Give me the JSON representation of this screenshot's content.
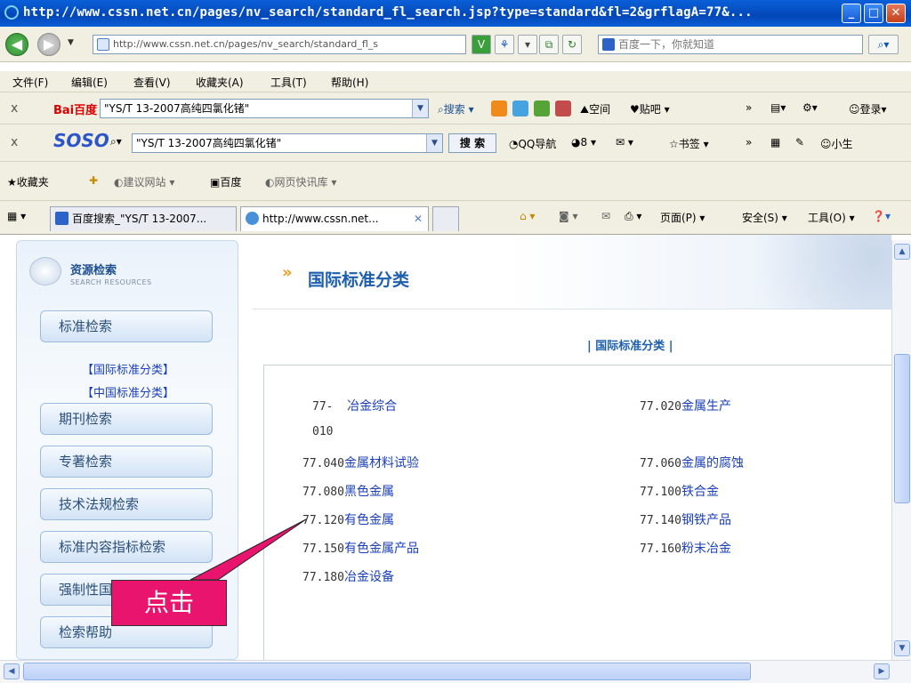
{
  "window": {
    "title": "http://www.cssn.net.cn/pages/nv_search/standard_fl_search.jsp?type=standard&fl=2&grflagA=77&..."
  },
  "address": {
    "url": "http://www.cssn.net.cn/pages/nv_search/standard_fl_s",
    "search_text": "百度一下，你就知道"
  },
  "menu": [
    "文件(F)",
    "编辑(E)",
    "查看(V)",
    "收藏夹(A)",
    "工具(T)",
    "帮助(H)"
  ],
  "baidu_toolbar": {
    "logo": "Bai百度",
    "query": "\"YS/T 13-2007高纯四氯化锗\"",
    "search": "搜索",
    "space": "空间",
    "tieba": "贴吧",
    "login": "登录"
  },
  "soso_toolbar": {
    "logo": "SOSO",
    "query": "\"YS/T 13-2007高纯四氯化锗\"",
    "search": "搜 索",
    "qqnav": "QQ导航",
    "count": "8",
    "bookmarks": "书签",
    "more": "»",
    "user": "小生"
  },
  "favorites_bar": {
    "favorites": "收藏夹",
    "suggested": "建议网站",
    "baidu": "百度",
    "webslice": "网页快讯库"
  },
  "tabs": [
    {
      "label": "百度搜索_\"YS/T 13-2007..."
    },
    {
      "label": "http://www.cssn.net..."
    }
  ],
  "ie_commands": {
    "page": "页面(P)",
    "safety": "安全(S)",
    "tools": "工具(O)"
  },
  "sidebar": {
    "title": "资源检索",
    "subtitle": "SEARCH RESOURCES",
    "items": [
      "标准检索",
      "期刊检索",
      "专著检索",
      "技术法规检索",
      "标准内容指标检索",
      "强制性国",
      "检索帮助"
    ],
    "sublinks": [
      "【国际标准分类】",
      "【中国标准分类】"
    ]
  },
  "content": {
    "title": "国际标准分类",
    "crumb": "| 国际标准分类 |",
    "categories": [
      {
        "code": "77-",
        "name": "冶金综合",
        "code2": "010"
      },
      {
        "code": "77.020",
        "name": "金属生产"
      },
      {
        "code": "77.040",
        "name": "金属材料试验"
      },
      {
        "code": "77.060",
        "name": "金属的腐蚀"
      },
      {
        "code": "77.080",
        "name": "黑色金属"
      },
      {
        "code": "77.100",
        "name": "铁合金"
      },
      {
        "code": "77.120",
        "name": "有色金属"
      },
      {
        "code": "77.140",
        "name": "钢铁产品"
      },
      {
        "code": "77.150",
        "name": "有色金属产品"
      },
      {
        "code": "77.160",
        "name": "粉末冶金"
      },
      {
        "code": "77.180",
        "name": "冶金设备"
      }
    ]
  },
  "callout": {
    "label": "点击"
  },
  "colors": {
    "accent": "#1d5fae",
    "link": "#1a3fb8",
    "callout": "#e8146d",
    "chevron": "#f39a1d"
  }
}
